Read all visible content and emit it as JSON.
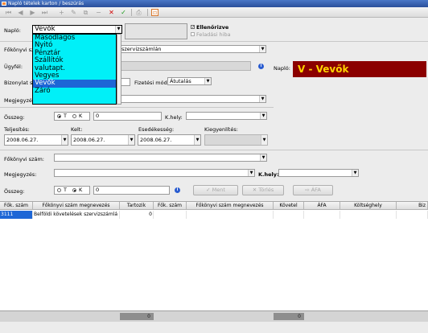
{
  "window": {
    "title": "Napló tételek karton / beszúrás"
  },
  "toolbar": {
    "icons": [
      "first-icon",
      "prev-icon",
      "next-icon",
      "last-icon",
      "insert-icon",
      "edit-icon",
      "copy-icon",
      "delete-icon",
      "cancel-icon",
      "confirm-icon",
      "print-icon",
      "exit-icon"
    ],
    "cancel_glyph": "✕",
    "confirm_glyph": "✓",
    "exit_glyph": "⊡"
  },
  "header": {
    "naplo_label": "Napló:",
    "naplo_value": "Vevők",
    "ellenorizve_label": "Ellenőrizve",
    "ellenorizve_checked": true,
    "feladasi_hiba_label": "Feladási hiba"
  },
  "dropdown": {
    "options": [
      "Másodlagos",
      "Nyitó",
      "Pénztár",
      "Szállítók",
      "valutapt.",
      "Vegyes",
      "Vevők",
      "Záró"
    ],
    "selected_index": 6
  },
  "form": {
    "fokonyvi_label": "Főkönyvi szá",
    "fokonyvi_value": "szervizszámlán",
    "ugyfel_label": "Ügyfél:",
    "naplo_right_label": "Napló:",
    "naplo_badge": "V - Vevők",
    "bizonylat_label": "Bizonylat sz",
    "fizetesi_mod_label": "Fizetési mód:",
    "fizetesi_mod_value": "Átutalás",
    "megjegyzes_label": "Megjegyzés:",
    "osszeg_label": "Összeg:",
    "radio_t": "T",
    "radio_k": "K",
    "osszeg_value": "0",
    "khely_label": "K.hely:",
    "teljesites_label": "Teljesítés:",
    "teljesites_value": "2008.06.27.",
    "kelt_label": "Kelt:",
    "kelt_value": "2008.06.27.",
    "esedekesseg_label": "Esedékesség:",
    "esedekesseg_value": "2008.06.27.",
    "kiegyenlites_label": "Kiegyenlítés:"
  },
  "form2": {
    "fokonyvi_label": "Főkönyvi szám:",
    "megjegyzes_label": "Megjegyzés:",
    "khely_label": "K.hely:",
    "osszeg_label": "Összeg:",
    "radio_t": "T",
    "radio_k": "K",
    "osszeg_value": "0",
    "mentes_label": "Ment",
    "torles_label": "Törlés",
    "afa_label": "ÁFA"
  },
  "grid": {
    "columns": [
      "Fők. szám",
      "Főkönyvi szám megnevezés",
      "Tartozik",
      "Fők. szám",
      "Főkönyvi szám megnevezés",
      "Követel",
      "ÁFA",
      "Költséghely",
      "Biz"
    ],
    "rows": [
      [
        "3111",
        "Belföldi követelések szervizszámlá",
        "0",
        "",
        "",
        "",
        "",
        "",
        ""
      ]
    ]
  },
  "footer": {
    "sum_left": "0",
    "sum_right": "0"
  }
}
